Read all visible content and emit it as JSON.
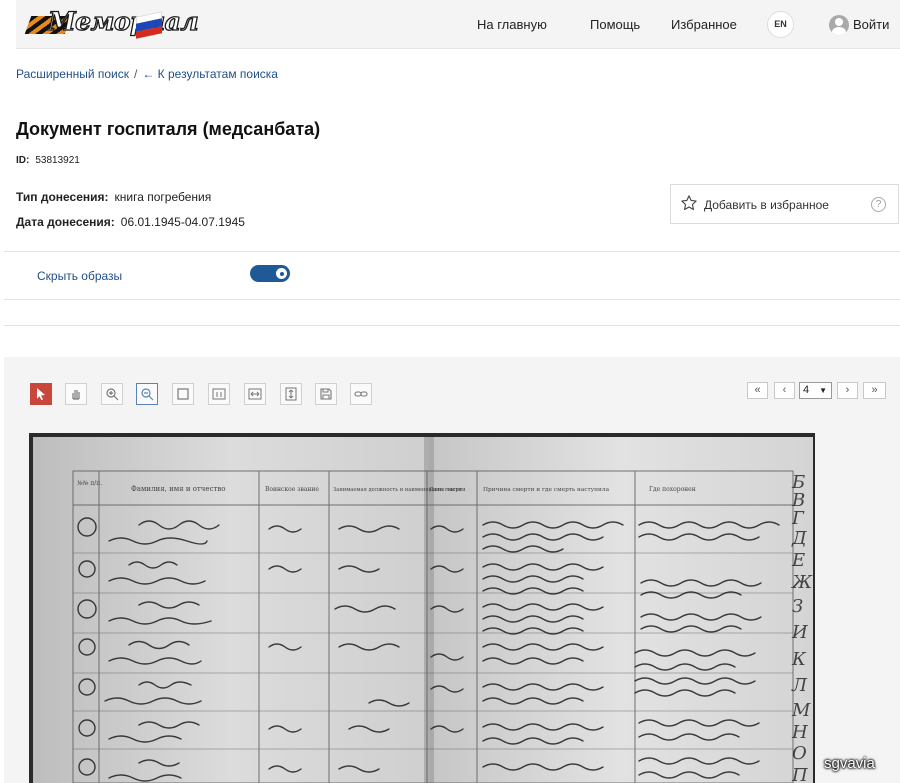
{
  "header": {
    "logo_text": "Мемориал",
    "nav": {
      "home": "На главную",
      "help": "Помощь",
      "favorites": "Избранное",
      "lang": "EN",
      "login": "Войти"
    }
  },
  "breadcrumb": {
    "advanced_search": "Расширенный поиск",
    "separator": "/",
    "back": "← К результатам поиска"
  },
  "document": {
    "title": "Документ госпиталя (медсанбата)",
    "id_label": "ID:",
    "id_value": "53813921",
    "report_type_label": "Тип донесения:",
    "report_type_value": "книга погребения",
    "report_date_label": "Дата донесения:",
    "report_date_value": "06.01.1945-04.07.1945"
  },
  "favorite": {
    "label": "Добавить в избранное",
    "help": "?"
  },
  "images": {
    "hide_label": "Скрыть образы",
    "toggle_on": true
  },
  "viewer": {
    "tools": [
      "pointer-icon",
      "hand-icon",
      "zoom-in-icon",
      "zoom-out-icon",
      "frame-icon",
      "actual-size-icon",
      "fit-width-icon",
      "fit-height-icon",
      "save-icon",
      "link-icon"
    ],
    "pager": {
      "first": "«",
      "prev": "‹",
      "page": "4",
      "next": "›",
      "last": "»"
    }
  },
  "scan": {
    "headers": [
      "№№ п/п.",
      "Фамилия, имя и отчество",
      "Воинское звание",
      "Занимаемая должность и наименование части",
      "Дата смерти",
      "Причина смерти и где смерть наступила",
      "Где похоронен"
    ],
    "letters": [
      "Б",
      "В",
      "Г",
      "Д",
      "Е",
      "Ж",
      "З",
      "И",
      "К",
      "Л",
      "М",
      "Н",
      "О",
      "П"
    ]
  },
  "watermark": "sgvavia",
  "colors": {
    "link": "#1f4f8b",
    "accent_red": "#c9463d",
    "toggle": "#1f5a96"
  }
}
